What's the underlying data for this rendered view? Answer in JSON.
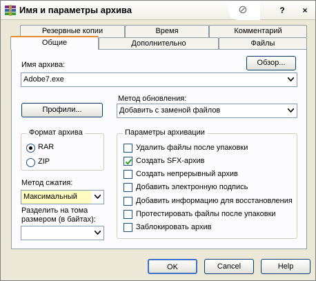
{
  "window": {
    "title": "Имя и параметры архива"
  },
  "titlebar_buttons": {
    "help": "?",
    "close": "×"
  },
  "tabs": {
    "row1": [
      "Резервные копии",
      "Время",
      "Комментарий"
    ],
    "row2": [
      "Общие",
      "Дополнительно",
      "Файлы"
    ],
    "active": "Общие"
  },
  "archive_name": {
    "label": "Имя архива:",
    "value": "Adobe7.exe",
    "browse_label": "Обзор..."
  },
  "profiles_button": "Профили...",
  "update_method": {
    "label": "Метод обновления:",
    "value": "Добавить с заменой файлов"
  },
  "archive_format": {
    "title": "Формат архива",
    "options": [
      "RAR",
      "ZIP"
    ],
    "selected": "RAR"
  },
  "compression": {
    "label": "Метод сжатия:",
    "value": "Максимальный"
  },
  "split": {
    "label_line1": "Разделить на тома",
    "label_line2": "размером (в байтах):",
    "value": ""
  },
  "archive_params": {
    "title": "Параметры архивации",
    "options": [
      {
        "label": "Удалить файлы после упаковки",
        "checked": false
      },
      {
        "label": "Создать SFX-архив",
        "checked": true
      },
      {
        "label": "Создать непрерывный архив",
        "checked": false
      },
      {
        "label": "Добавить электронную подпись",
        "checked": false
      },
      {
        "label": "Добавить информацию для восстановления",
        "checked": false
      },
      {
        "label": "Протестировать файлы после упаковки",
        "checked": false
      },
      {
        "label": "Заблокировать архив",
        "checked": false
      }
    ]
  },
  "footer": {
    "ok": "OK",
    "cancel": "Cancel",
    "help": "Help"
  },
  "icons": {
    "app": "winrar-icon",
    "title_extra": "no-entry-icon"
  }
}
